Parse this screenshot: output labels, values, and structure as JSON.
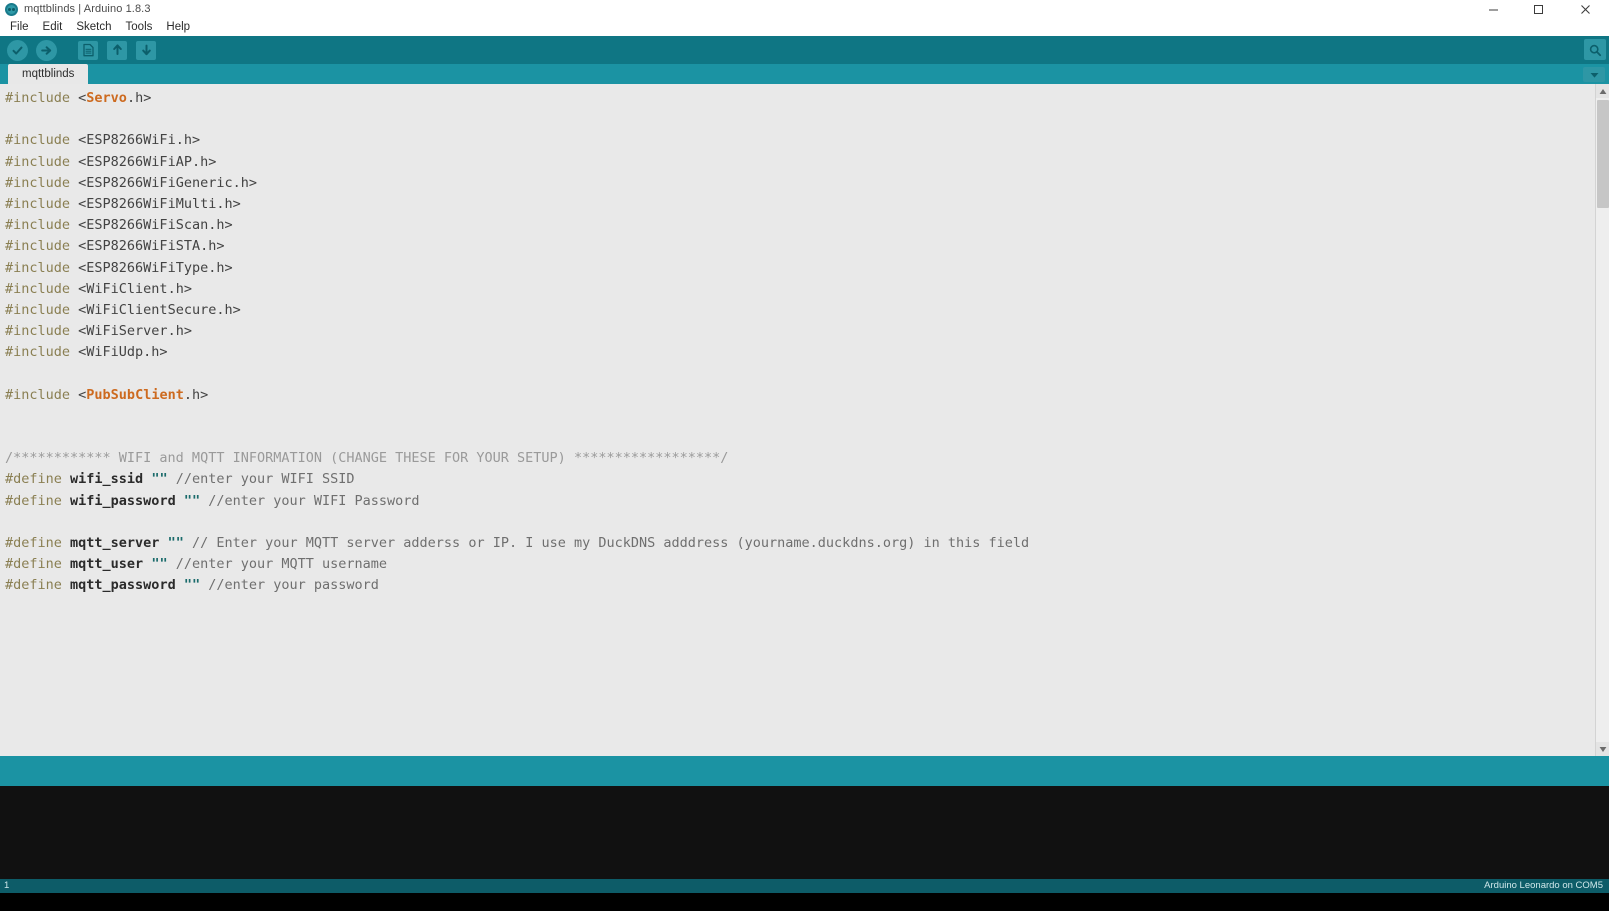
{
  "window": {
    "title": "mqttblinds | Arduino 1.8.3",
    "logo_icon": "arduino-logo-icon",
    "controls": [
      {
        "name": "minimize-button",
        "icon": "minimize-icon",
        "label": "─"
      },
      {
        "name": "maximize-button",
        "icon": "maximize-icon",
        "label": "☐"
      },
      {
        "name": "close-button",
        "icon": "close-icon",
        "label": "✕"
      }
    ]
  },
  "menubar": {
    "items": [
      {
        "label": "File"
      },
      {
        "label": "Edit"
      },
      {
        "label": "Sketch"
      },
      {
        "label": "Tools"
      },
      {
        "label": "Help"
      }
    ]
  },
  "toolbar": {
    "verify_label": "Verify",
    "upload_label": "Upload",
    "new_label": "New",
    "open_label": "Open",
    "save_label": "Save",
    "serial_monitor_label": "Serial Monitor",
    "icons": {
      "verify": "check-icon",
      "upload": "arrow-right-icon",
      "new": "document-icon",
      "open": "arrow-up-icon",
      "save": "arrow-down-icon",
      "serial_monitor": "magnifier-icon"
    }
  },
  "tabbar": {
    "tabs": [
      {
        "label": "mqttblinds",
        "active": true
      }
    ],
    "menu_icon": "chevron-down-icon"
  },
  "editor": {
    "lines": [
      {
        "tokens": [
          {
            "c": "t-pre",
            "t": "#include"
          },
          {
            "c": "t-plain",
            "t": " <"
          },
          {
            "c": "t-lib",
            "t": "Servo"
          },
          {
            "c": "t-plain",
            "t": ".h>"
          }
        ]
      },
      {
        "tokens": []
      },
      {
        "tokens": [
          {
            "c": "t-pre",
            "t": "#include"
          },
          {
            "c": "t-plain",
            "t": " <ESP8266WiFi.h>"
          }
        ]
      },
      {
        "tokens": [
          {
            "c": "t-pre",
            "t": "#include"
          },
          {
            "c": "t-plain",
            "t": " <ESP8266WiFiAP.h>"
          }
        ]
      },
      {
        "tokens": [
          {
            "c": "t-pre",
            "t": "#include"
          },
          {
            "c": "t-plain",
            "t": " <ESP8266WiFiGeneric.h>"
          }
        ]
      },
      {
        "tokens": [
          {
            "c": "t-pre",
            "t": "#include"
          },
          {
            "c": "t-plain",
            "t": " <ESP8266WiFiMulti.h>"
          }
        ]
      },
      {
        "tokens": [
          {
            "c": "t-pre",
            "t": "#include"
          },
          {
            "c": "t-plain",
            "t": " <ESP8266WiFiScan.h>"
          }
        ]
      },
      {
        "tokens": [
          {
            "c": "t-pre",
            "t": "#include"
          },
          {
            "c": "t-plain",
            "t": " <ESP8266WiFiSTA.h>"
          }
        ]
      },
      {
        "tokens": [
          {
            "c": "t-pre",
            "t": "#include"
          },
          {
            "c": "t-plain",
            "t": " <ESP8266WiFiType.h>"
          }
        ]
      },
      {
        "tokens": [
          {
            "c": "t-pre",
            "t": "#include"
          },
          {
            "c": "t-plain",
            "t": " <WiFiClient.h>"
          }
        ]
      },
      {
        "tokens": [
          {
            "c": "t-pre",
            "t": "#include"
          },
          {
            "c": "t-plain",
            "t": " <WiFiClientSecure.h>"
          }
        ]
      },
      {
        "tokens": [
          {
            "c": "t-pre",
            "t": "#include"
          },
          {
            "c": "t-plain",
            "t": " <WiFiServer.h>"
          }
        ]
      },
      {
        "tokens": [
          {
            "c": "t-pre",
            "t": "#include"
          },
          {
            "c": "t-plain",
            "t": " <WiFiUdp.h>"
          }
        ]
      },
      {
        "tokens": []
      },
      {
        "tokens": [
          {
            "c": "t-pre",
            "t": "#include"
          },
          {
            "c": "t-plain",
            "t": " <"
          },
          {
            "c": "t-lib",
            "t": "PubSubClient"
          },
          {
            "c": "t-plain",
            "t": ".h>"
          }
        ]
      },
      {
        "tokens": []
      },
      {
        "tokens": []
      },
      {
        "tokens": [
          {
            "c": "t-cmt",
            "t": "/************ WIFI and MQTT INFORMATION (CHANGE THESE FOR YOUR SETUP) ******************/"
          }
        ]
      },
      {
        "tokens": [
          {
            "c": "t-pre",
            "t": "#define"
          },
          {
            "c": "t-name",
            "t": " wifi_ssid "
          },
          {
            "c": "t-str",
            "t": "\"\""
          },
          {
            "c": "t-cmt2",
            "t": " //enter your WIFI SSID"
          }
        ]
      },
      {
        "tokens": [
          {
            "c": "t-pre",
            "t": "#define"
          },
          {
            "c": "t-name",
            "t": " wifi_password "
          },
          {
            "c": "t-str",
            "t": "\"\""
          },
          {
            "c": "t-cmt2",
            "t": " //enter your WIFI Password"
          }
        ]
      },
      {
        "tokens": []
      },
      {
        "tokens": [
          {
            "c": "t-pre",
            "t": "#define"
          },
          {
            "c": "t-name",
            "t": " mqtt_server "
          },
          {
            "c": "t-str",
            "t": "\"\""
          },
          {
            "c": "t-cmt2",
            "t": " // Enter your MQTT server adderss or IP. I use my DuckDNS adddress (yourname.duckdns.org) in this field"
          }
        ]
      },
      {
        "tokens": [
          {
            "c": "t-pre",
            "t": "#define"
          },
          {
            "c": "t-name",
            "t": " mqtt_user "
          },
          {
            "c": "t-str",
            "t": "\"\""
          },
          {
            "c": "t-cmt2",
            "t": " //enter your MQTT username"
          }
        ]
      },
      {
        "tokens": [
          {
            "c": "t-pre",
            "t": "#define"
          },
          {
            "c": "t-name",
            "t": " mqtt_password "
          },
          {
            "c": "t-str",
            "t": "\"\""
          },
          {
            "c": "t-cmt2",
            "t": " //enter your password"
          }
        ]
      }
    ]
  },
  "scrollbar": {
    "up_icon": "scroll-up-icon",
    "down_icon": "scroll-down-icon"
  },
  "console": {
    "message_text": "",
    "output_text": ""
  },
  "statusbar": {
    "line_number": "1",
    "board": "Arduino Leonardo on COM5"
  },
  "colors": {
    "teal_toolbar": "#0f7684",
    "teal_tabbar": "#1b93a3",
    "status_teal": "#0d5c68",
    "editor_bg": "#e9e9e9",
    "console_bg": "#111111",
    "lib_orange": "#cd6a1f",
    "preproc_olive": "#8a7f52",
    "string_teal": "#1a6b6b"
  }
}
